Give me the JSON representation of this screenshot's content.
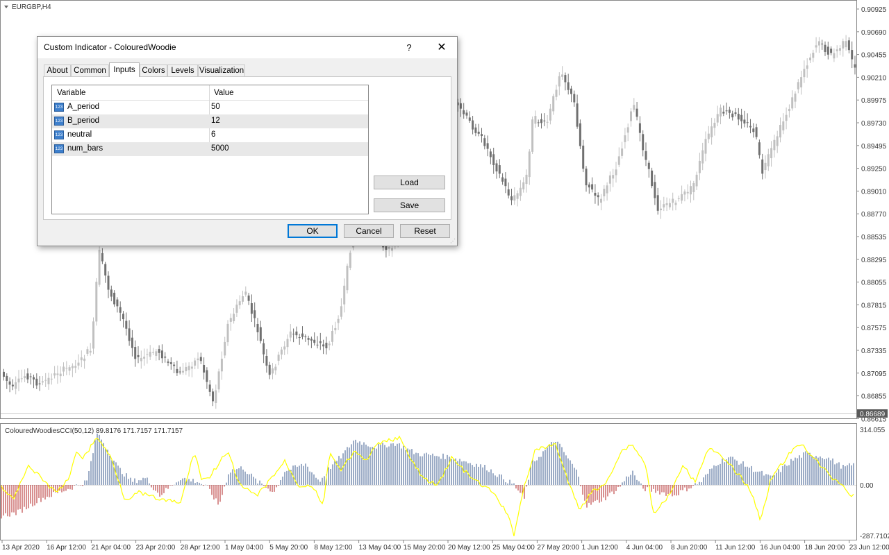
{
  "chart_title": "EURGBP,H4",
  "price_axis": [
    "0.90925",
    "0.90690",
    "0.90455",
    "0.90210",
    "0.89975",
    "0.89730",
    "0.89495",
    "0.89250",
    "0.89010",
    "0.88770",
    "0.88535",
    "0.88295",
    "0.88055",
    "0.87815",
    "0.87575",
    "0.87335",
    "0.87095",
    "0.86855",
    "0.86615"
  ],
  "current_price": "0.86689",
  "indicator_label": "ColouredWoodiesCCI(50,12) 89.8176 171.7157 171.7157",
  "indicator_axis": {
    "top": "314.055",
    "mid": "0.00",
    "bottom": "-287.7102"
  },
  "time_axis": [
    "13 Apr 2020",
    "16 Apr 12:00",
    "21 Apr 04:00",
    "23 Apr 20:00",
    "28 Apr 12:00",
    "1 May 04:00",
    "5 May 20:00",
    "8 May 12:00",
    "13 May 04:00",
    "15 May 20:00",
    "20 May 12:00",
    "25 May 04:00",
    "27 May 20:00",
    "1 Jun 12:00",
    "4 Jun 04:00",
    "8 Jun 20:00",
    "11 Jun 12:00",
    "16 Jun 04:00",
    "18 Jun 20:00",
    "23 Jun 12:00"
  ],
  "colors": {
    "bull": "#c0c0c0",
    "bear": "#707070",
    "hist_pos": "#3a5a8c",
    "hist_neg": "#b02020",
    "cci_line": "#ffff00",
    "accent": "#0078d7"
  },
  "dialog": {
    "title": "Custom Indicator - ColouredWoodie",
    "help": "?",
    "close": "✕",
    "tabs": [
      "About",
      "Common",
      "Inputs",
      "Colors",
      "Levels",
      "Visualization"
    ],
    "active_tab": "Inputs",
    "table": {
      "headers": [
        "Variable",
        "Value"
      ],
      "rows": [
        {
          "icon": "123",
          "name": "A_period",
          "value": "50"
        },
        {
          "icon": "123",
          "name": "B_period",
          "value": "12"
        },
        {
          "icon": "123",
          "name": "neutral",
          "value": "6"
        },
        {
          "icon": "123",
          "name": "num_bars",
          "value": "5000"
        }
      ]
    },
    "load": "Load",
    "save": "Save",
    "ok": "OK",
    "cancel": "Cancel",
    "reset": "Reset"
  }
}
